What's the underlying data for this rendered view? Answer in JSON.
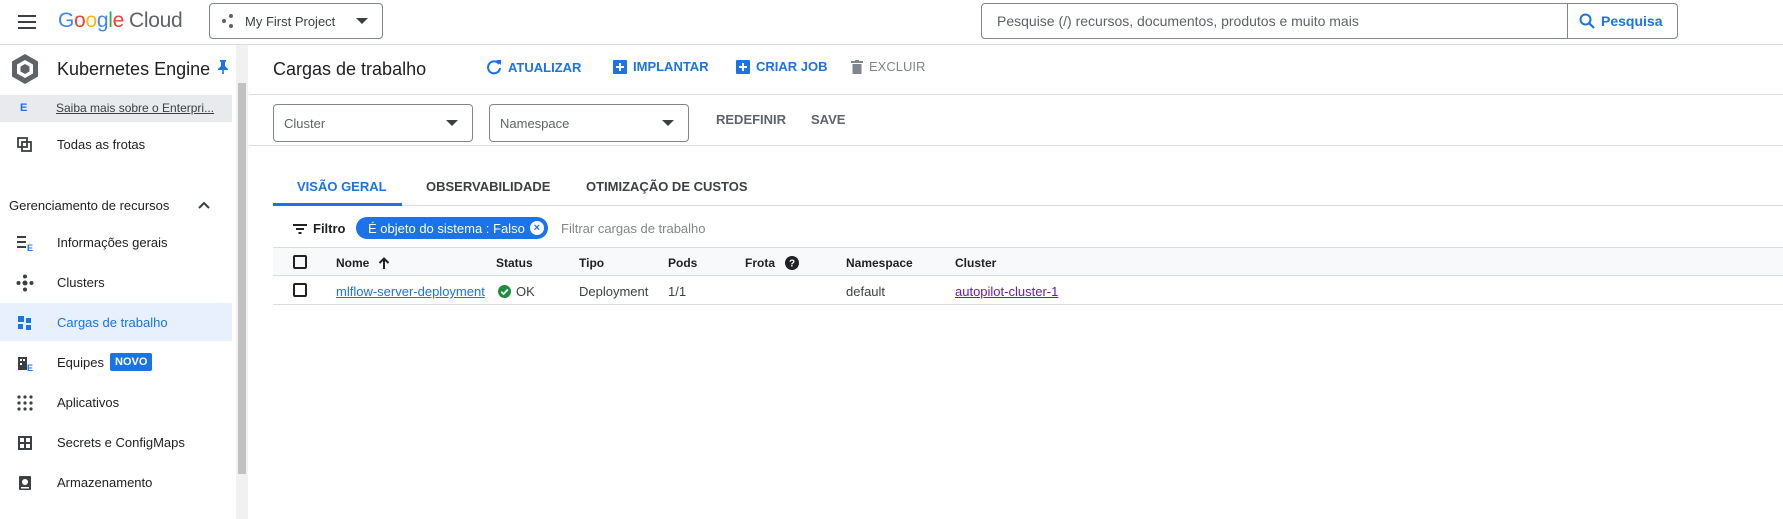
{
  "header": {
    "logo": {
      "google": [
        "G",
        "o",
        "o",
        "g",
        "l",
        "e"
      ],
      "cloud": "Cloud"
    },
    "project": "My First Project",
    "search_placeholder": "Pesquise (/) recursos, documentos, produtos e muito mais",
    "search_button": "Pesquisa"
  },
  "sidebar": {
    "product": "Kubernetes Engine",
    "promo_letter": "E",
    "promo_text": "Saiba mais sobre o Enterpri...",
    "fleets": "Todas as frotas",
    "section": "Gerenciamento de recursos",
    "items": [
      {
        "label": "Informações gerais",
        "icon": "overview-icon"
      },
      {
        "label": "Clusters",
        "icon": "clusters-icon"
      },
      {
        "label": "Cargas de trabalho",
        "icon": "workloads-icon",
        "active": true
      },
      {
        "label": "Equipes",
        "icon": "teams-icon",
        "badge": "NOVO"
      },
      {
        "label": "Aplicativos",
        "icon": "apps-grid-icon"
      },
      {
        "label": "Secrets e ConfigMaps",
        "icon": "secrets-icon"
      },
      {
        "label": "Armazenamento",
        "icon": "storage-icon"
      }
    ]
  },
  "main": {
    "title": "Cargas de trabalho",
    "actions": {
      "refresh": "ATUALIZAR",
      "deploy": "IMPLANTAR",
      "create_job": "CRIAR JOB",
      "delete": "EXCLUIR"
    },
    "filters": {
      "cluster_placeholder": "Cluster",
      "namespace_placeholder": "Namespace",
      "reset": "REDEFINIR",
      "save": "SAVE"
    },
    "tabs": [
      "VISÃO GERAL",
      "OBSERVABILIDADE",
      "OTIMIZAÇÃO DE CUSTOS"
    ],
    "filter_label": "Filtro",
    "filter_chip": "É objeto do sistema : Falso",
    "filter_placeholder": "Filtrar cargas de trabalho",
    "table": {
      "columns": [
        "Nome",
        "Status",
        "Tipo",
        "Pods",
        "Frota",
        "Namespace",
        "Cluster"
      ],
      "rows": [
        {
          "name": "mlflow-server-deployment",
          "status": "OK",
          "type": "Deployment",
          "pods": "1/1",
          "fleet": "",
          "namespace": "default",
          "cluster": "autopilot-cluster-1"
        }
      ]
    }
  },
  "colors": {
    "accent": "#1a73e8",
    "ok": "#1e8e3e",
    "visited_link": "#681da8"
  }
}
